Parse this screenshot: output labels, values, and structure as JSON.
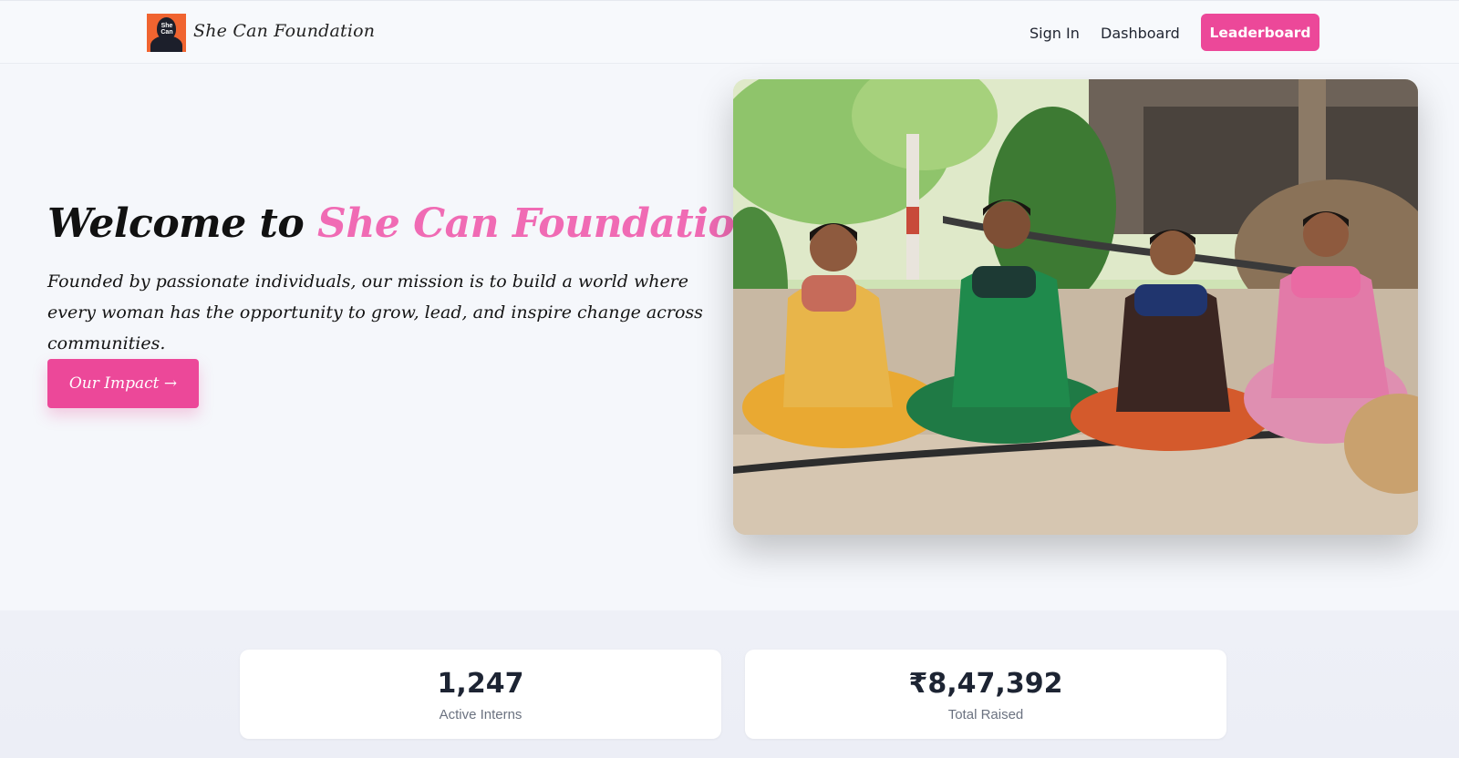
{
  "header": {
    "brand_name": "She Can Foundation",
    "logo_text": "She Can",
    "nav": {
      "sign_in": "Sign In",
      "dashboard": "Dashboard",
      "leaderboard": "Leaderboard"
    }
  },
  "hero": {
    "title_prefix": "Welcome to ",
    "title_accent": "She Can Foundation",
    "description": "Founded by passionate individuals, our mission is to build a world where every woman has the opportunity to grow, lead, and inspire change across communities.",
    "cta_label": "Our Impact →",
    "image_icon": "hero-photo"
  },
  "stats": [
    {
      "value": "1,247",
      "label": "Active Interns"
    },
    {
      "value": "₹8,47,392",
      "label": "Total Raised"
    }
  ],
  "colors": {
    "accent": "#ec4899",
    "accent_text": "#f06bb4",
    "logo_bg": "#f06430",
    "page_bg": "#f5f7fb"
  }
}
